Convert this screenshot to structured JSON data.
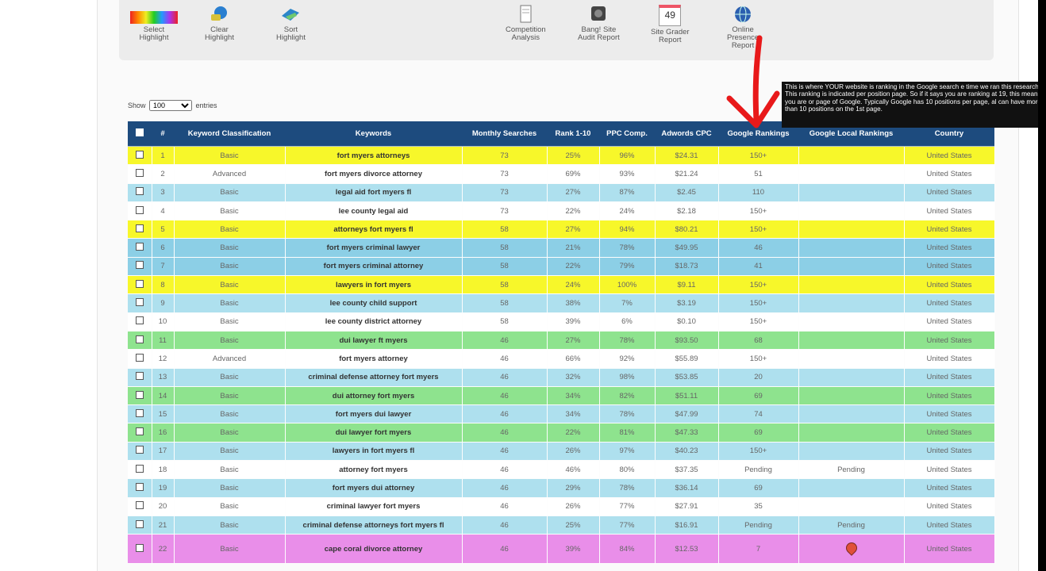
{
  "toolbar": {
    "select_highlight": "Select\nHighlight",
    "clear_highlight": "Clear\nHighlight",
    "sort_highlight": "Sort\nHighlight",
    "competition_analysis": "Competition\nAnalysis",
    "bang_site_audit": "Bang! Site\nAudit Report",
    "site_grader_value": "49",
    "site_grader": "Site Grader\nReport",
    "online_presence": "Online\nPresence\nReport"
  },
  "show": {
    "prefix": "Show",
    "value": "100",
    "suffix": "entries"
  },
  "tooltip": "This is where YOUR website is ranking in the Google search e time we ran this research. This ranking is indicated per position page. So if it says you are ranking at 19, this means you are or page of Google. Typically Google has 10 positions per page, al can have more than 10 positions on the 1st page.",
  "columns": [
    "#",
    "Keyword Classification",
    "Keywords",
    "Monthly Searches",
    "Rank 1-10",
    "PPC Comp.",
    "Adwords CPC",
    "Google Rankings",
    "Google Local Rankings",
    "Country"
  ],
  "colors": {
    "yellow": "#f7f72a",
    "white": "#ffffff",
    "lightblue": "#aee0ee",
    "blue": "#8ccfe6",
    "green": "#8ee38e",
    "magenta": "#e98ee9",
    "header": "#1d4b7e"
  },
  "rows": [
    {
      "n": "1",
      "cls": "Basic",
      "kw": "fort myers attorneys",
      "ms": "73",
      "rank": "25%",
      "ppc": "96%",
      "cpc": "$24.31",
      "gr": "150+",
      "glr": "",
      "country": "United States",
      "color": "yellow"
    },
    {
      "n": "2",
      "cls": "Advanced",
      "kw": "fort myers divorce attorney",
      "ms": "73",
      "rank": "69%",
      "ppc": "93%",
      "cpc": "$21.24",
      "gr": "51",
      "glr": "",
      "country": "United States",
      "color": "white"
    },
    {
      "n": "3",
      "cls": "Basic",
      "kw": "legal aid fort myers fl",
      "ms": "73",
      "rank": "27%",
      "ppc": "87%",
      "cpc": "$2.45",
      "gr": "110",
      "glr": "",
      "country": "United States",
      "color": "lightblue"
    },
    {
      "n": "4",
      "cls": "Basic",
      "kw": "lee county legal aid",
      "ms": "73",
      "rank": "22%",
      "ppc": "24%",
      "cpc": "$2.18",
      "gr": "150+",
      "glr": "",
      "country": "United States",
      "color": "white"
    },
    {
      "n": "5",
      "cls": "Basic",
      "kw": "attorneys fort myers fl",
      "ms": "58",
      "rank": "27%",
      "ppc": "94%",
      "cpc": "$80.21",
      "gr": "150+",
      "glr": "",
      "country": "United States",
      "color": "yellow"
    },
    {
      "n": "6",
      "cls": "Basic",
      "kw": "fort myers criminal lawyer",
      "ms": "58",
      "rank": "21%",
      "ppc": "78%",
      "cpc": "$49.95",
      "gr": "46",
      "glr": "",
      "country": "United States",
      "color": "blue"
    },
    {
      "n": "7",
      "cls": "Basic",
      "kw": "fort myers criminal attorney",
      "ms": "58",
      "rank": "22%",
      "ppc": "79%",
      "cpc": "$18.73",
      "gr": "41",
      "glr": "",
      "country": "United States",
      "color": "blue"
    },
    {
      "n": "8",
      "cls": "Basic",
      "kw": "lawyers in fort myers",
      "ms": "58",
      "rank": "24%",
      "ppc": "100%",
      "cpc": "$9.11",
      "gr": "150+",
      "glr": "",
      "country": "United States",
      "color": "yellow"
    },
    {
      "n": "9",
      "cls": "Basic",
      "kw": "lee county child support",
      "ms": "58",
      "rank": "38%",
      "ppc": "7%",
      "cpc": "$3.19",
      "gr": "150+",
      "glr": "",
      "country": "United States",
      "color": "lightblue"
    },
    {
      "n": "10",
      "cls": "Basic",
      "kw": "lee county district attorney",
      "ms": "58",
      "rank": "39%",
      "ppc": "6%",
      "cpc": "$0.10",
      "gr": "150+",
      "glr": "",
      "country": "United States",
      "color": "white"
    },
    {
      "n": "11",
      "cls": "Basic",
      "kw": "dui lawyer ft myers",
      "ms": "46",
      "rank": "27%",
      "ppc": "78%",
      "cpc": "$93.50",
      "gr": "68",
      "glr": "",
      "country": "United States",
      "color": "green"
    },
    {
      "n": "12",
      "cls": "Advanced",
      "kw": "fort myers attorney",
      "ms": "46",
      "rank": "66%",
      "ppc": "92%",
      "cpc": "$55.89",
      "gr": "150+",
      "glr": "",
      "country": "United States",
      "color": "white"
    },
    {
      "n": "13",
      "cls": "Basic",
      "kw": "criminal defense attorney fort myers",
      "ms": "46",
      "rank": "32%",
      "ppc": "98%",
      "cpc": "$53.85",
      "gr": "20",
      "glr": "",
      "country": "United States",
      "color": "lightblue"
    },
    {
      "n": "14",
      "cls": "Basic",
      "kw": "dui attorney fort myers",
      "ms": "46",
      "rank": "34%",
      "ppc": "82%",
      "cpc": "$51.11",
      "gr": "69",
      "glr": "",
      "country": "United States",
      "color": "green"
    },
    {
      "n": "15",
      "cls": "Basic",
      "kw": "fort myers dui lawyer",
      "ms": "46",
      "rank": "34%",
      "ppc": "78%",
      "cpc": "$47.99",
      "gr": "74",
      "glr": "",
      "country": "United States",
      "color": "lightblue"
    },
    {
      "n": "16",
      "cls": "Basic",
      "kw": "dui lawyer fort myers",
      "ms": "46",
      "rank": "22%",
      "ppc": "81%",
      "cpc": "$47.33",
      "gr": "69",
      "glr": "",
      "country": "United States",
      "color": "green"
    },
    {
      "n": "17",
      "cls": "Basic",
      "kw": "lawyers in fort myers fl",
      "ms": "46",
      "rank": "26%",
      "ppc": "97%",
      "cpc": "$40.23",
      "gr": "150+",
      "glr": "",
      "country": "United States",
      "color": "lightblue"
    },
    {
      "n": "18",
      "cls": "Basic",
      "kw": "attorney fort myers",
      "ms": "46",
      "rank": "46%",
      "ppc": "80%",
      "cpc": "$37.35",
      "gr": "Pending",
      "glr": "Pending",
      "country": "United States",
      "color": "white"
    },
    {
      "n": "19",
      "cls": "Basic",
      "kw": "fort myers dui attorney",
      "ms": "46",
      "rank": "29%",
      "ppc": "78%",
      "cpc": "$36.14",
      "gr": "69",
      "glr": "",
      "country": "United States",
      "color": "lightblue"
    },
    {
      "n": "20",
      "cls": "Basic",
      "kw": "criminal lawyer fort myers",
      "ms": "46",
      "rank": "26%",
      "ppc": "77%",
      "cpc": "$27.91",
      "gr": "35",
      "glr": "",
      "country": "United States",
      "color": "white"
    },
    {
      "n": "21",
      "cls": "Basic",
      "kw": "criminal defense attorneys fort myers fl",
      "ms": "46",
      "rank": "25%",
      "ppc": "77%",
      "cpc": "$16.91",
      "gr": "Pending",
      "glr": "Pending",
      "country": "United States",
      "color": "lightblue"
    },
    {
      "n": "22",
      "cls": "Basic",
      "kw": "cape coral divorce attorney",
      "ms": "46",
      "rank": "39%",
      "ppc": "84%",
      "cpc": "$12.53",
      "gr": "7",
      "glr": "map-pin-icon",
      "country": "United States",
      "color": "magenta"
    }
  ]
}
